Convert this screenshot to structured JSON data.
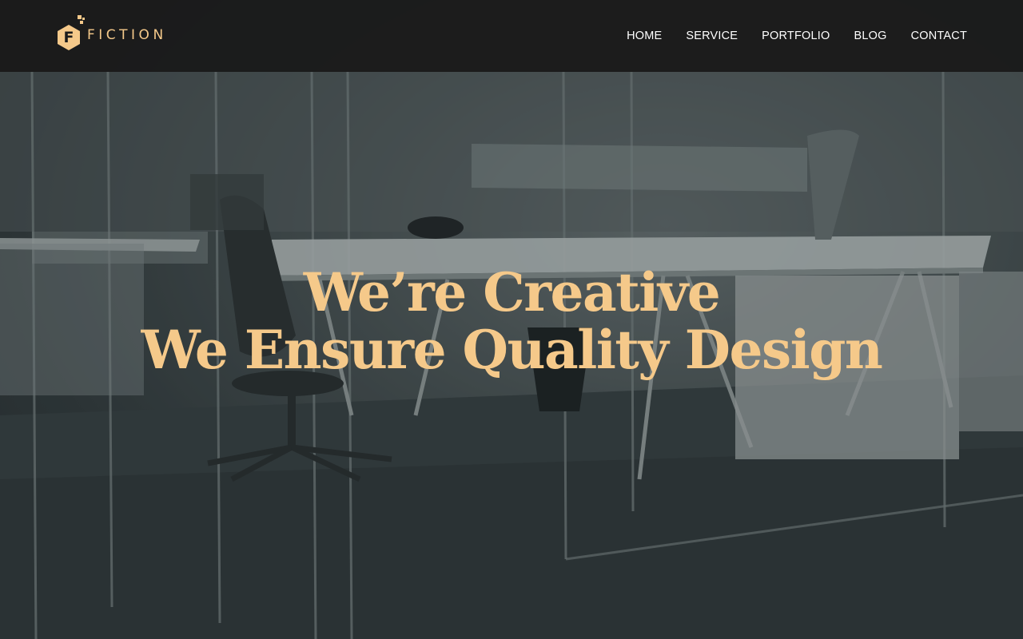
{
  "brand": {
    "name": "FICTION",
    "logo_letter": "F",
    "accent_color": "#f5c98a"
  },
  "nav": {
    "items": [
      {
        "label": "HOME"
      },
      {
        "label": "SERVICE"
      },
      {
        "label": "PORTFOLIO"
      },
      {
        "label": "BLOG"
      },
      {
        "label": "CONTACT"
      }
    ]
  },
  "hero": {
    "headline_line1": "We’re Creative",
    "headline_line2": "We Ensure Quality Design",
    "background": "office-interior-photo"
  }
}
